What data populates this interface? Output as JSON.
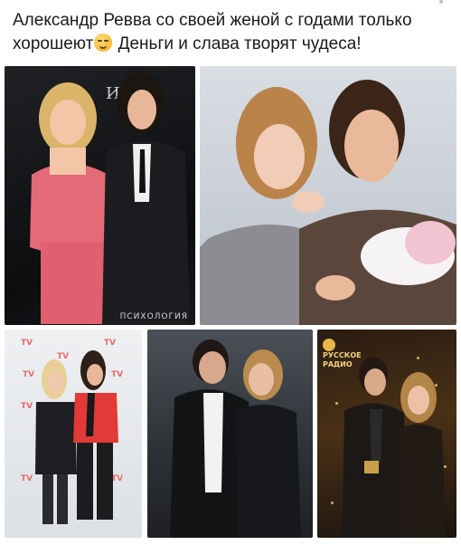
{
  "post": {
    "text_before_emoji": "Александр Ревва со своей женой с годами только хорошеют",
    "emoji": "smirking-face-icon",
    "text_after_emoji": " Деньги и слава творят чудеса!"
  },
  "gallery": {
    "photo1": {
      "watermark": "ПСИХОЛОГИЯ",
      "backdrop_logo": "ИК"
    },
    "photo3": {
      "backdrop_brand": "TV"
    },
    "photo5": {
      "backdrop_brand": "РУССКОЕ РАДИО"
    }
  },
  "colors": {
    "text": "#1a1a1a",
    "background": "#ffffff"
  }
}
